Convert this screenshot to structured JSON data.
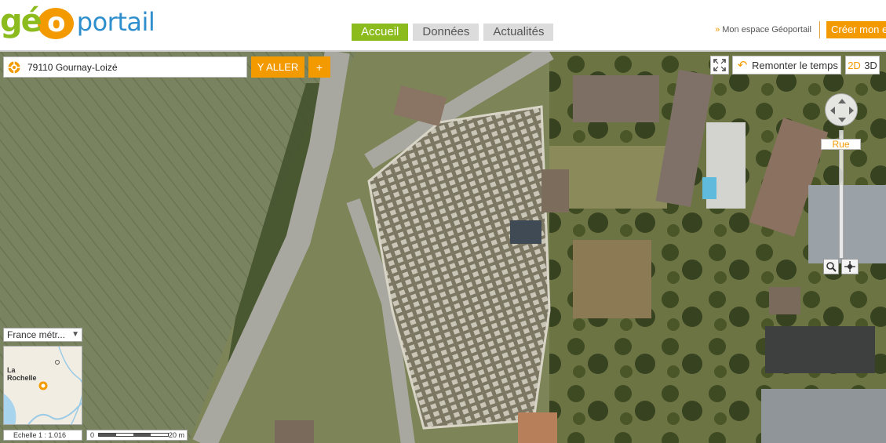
{
  "header": {
    "logo": {
      "text": "géo portail",
      "geo": "géo",
      "g": "g",
      "e": "é",
      "o": "o",
      "portail": "portail"
    },
    "nav": [
      {
        "label": "Accueil",
        "active": true
      },
      {
        "label": "Données",
        "active": false
      },
      {
        "label": "Actualités",
        "active": false
      }
    ],
    "espace_link": "Mon espace Géoportail",
    "create_button": "Créer mon e"
  },
  "search": {
    "value": "79110 Gournay-Loizé",
    "go_label": "Y ALLER",
    "plus_label": "+"
  },
  "map_controls": {
    "time_button": "Remonter le temps",
    "view_2d": "2D",
    "view_3d": "3D",
    "zoom_level": "Rue"
  },
  "overview": {
    "territory": "France métr...",
    "city_label": "La Rochelle"
  },
  "scale": {
    "ratio": "Echelle 1 :  1.016",
    "zero": "0",
    "distance": "20 m"
  },
  "colors": {
    "accent_green": "#8bbb1c",
    "accent_orange": "#f39a00",
    "logo_blue": "#2f8fcd"
  }
}
